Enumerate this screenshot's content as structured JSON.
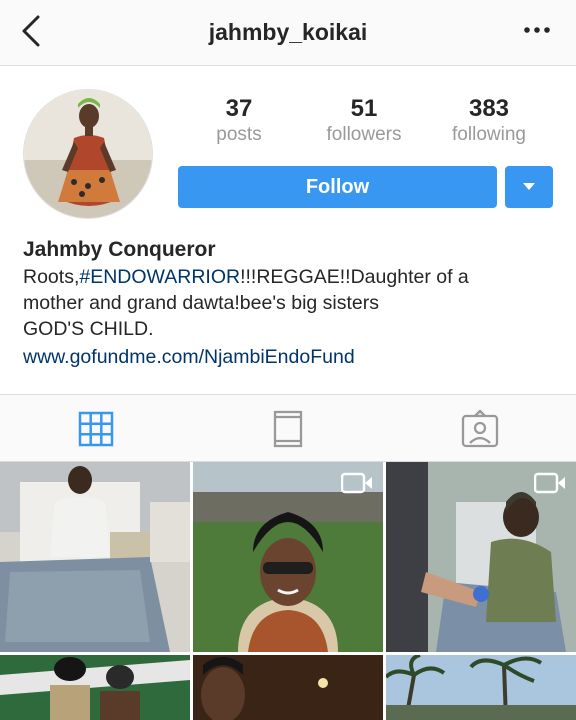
{
  "header": {
    "username": "jahmby_koikai",
    "back_icon": "chevron-left-icon",
    "more_icon": "more-horizontal-icon"
  },
  "profile": {
    "stats": {
      "posts_value": "37",
      "posts_label": "posts",
      "followers_value": "51",
      "followers_label": "followers",
      "following_value": "383",
      "following_label": "following"
    },
    "follow_label": "Follow",
    "display_name": "Jahmby Conqueror",
    "bio": {
      "line1_prefix": "Roots,",
      "line1_hashtag": "#ENDOWARRIOR",
      "line1_suffix": "!!!REGGAE!!Daughter of a",
      "line2": "mother and grand dawta!bee's big sisters",
      "line3": "GOD'S CHILD.",
      "website": "www.gofundme.com/NjambiEndoFund"
    }
  },
  "tabs": [
    {
      "icon": "grid-icon",
      "active": true
    },
    {
      "icon": "feed-icon",
      "active": false
    },
    {
      "icon": "tagged-icon",
      "active": false
    }
  ],
  "colors": {
    "accent": "#3897f0",
    "link": "#003569",
    "muted": "#999999"
  }
}
